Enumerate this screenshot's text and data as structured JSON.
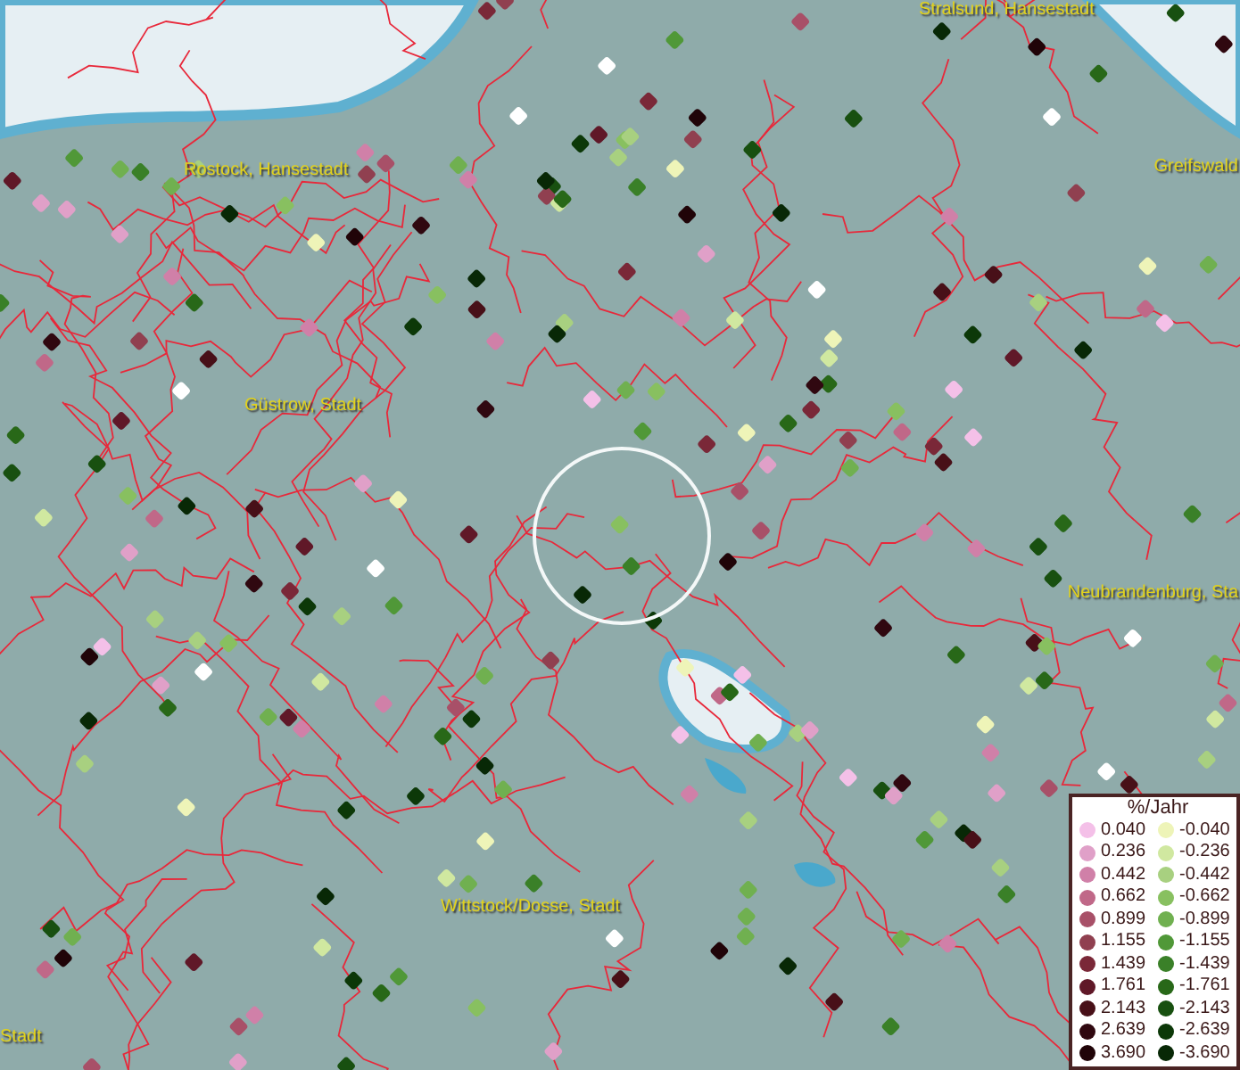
{
  "places": [
    "Stralsund, Hansestadt",
    "Rostock, Hansestadt",
    "Greifswald",
    "Güstrow, Stadt",
    "Neubrandenburg, Sta",
    "Wittstock/Dosse, Stadt",
    "Stadt"
  ],
  "legend": {
    "title": "%/Jahr",
    "positive": [
      {
        "label": "0.040",
        "color": "#f4c0e8"
      },
      {
        "label": "0.236",
        "color": "#e0a0c8"
      },
      {
        "label": "0.442",
        "color": "#d080a8"
      },
      {
        "label": "0.662",
        "color": "#c06888"
      },
      {
        "label": "0.899",
        "color": "#a85068"
      },
      {
        "label": "1.155",
        "color": "#904050"
      },
      {
        "label": "1.439",
        "color": "#7a2838"
      },
      {
        "label": "1.761",
        "color": "#601828"
      },
      {
        "label": "2.143",
        "color": "#481018"
      },
      {
        "label": "2.639",
        "color": "#300810"
      },
      {
        "label": "3.690",
        "color": "#200408"
      }
    ],
    "negative": [
      {
        "label": "-0.040",
        "color": "#eef4b8"
      },
      {
        "label": "-0.236",
        "color": "#d0e8a0"
      },
      {
        "label": "-0.442",
        "color": "#a8d080"
      },
      {
        "label": "-0.662",
        "color": "#88c060"
      },
      {
        "label": "-0.899",
        "color": "#70b050"
      },
      {
        "label": "-1.155",
        "color": "#509838"
      },
      {
        "label": "-1.439",
        "color": "#3a8028"
      },
      {
        "label": "-1.761",
        "color": "#286818"
      },
      {
        "label": "-2.143",
        "color": "#185010"
      },
      {
        "label": "-2.639",
        "color": "#0c3808"
      },
      {
        "label": "-3.690",
        "color": "#082806"
      }
    ]
  }
}
